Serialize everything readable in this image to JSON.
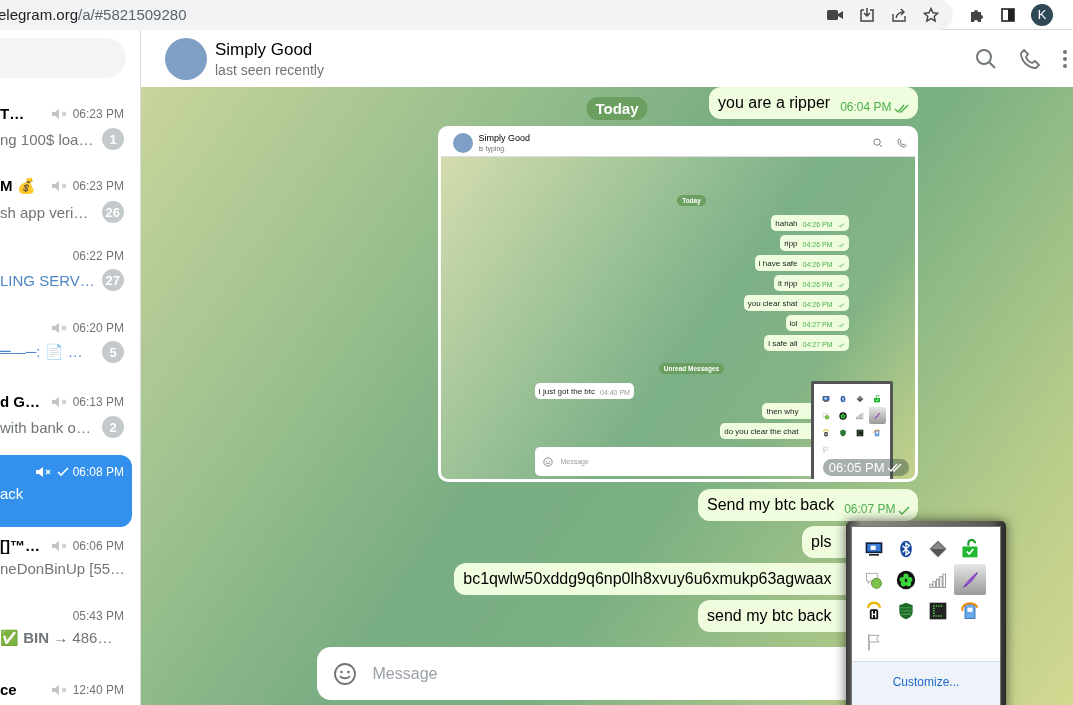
{
  "browser": {
    "url_host": "elegram.org",
    "url_path": "/a/#5821509280",
    "profile_initial": "K"
  },
  "sidebar": {
    "chats": [
      {
        "title": "T…",
        "muted": true,
        "sent_check": false,
        "time": "06:23 PM",
        "preview": "ng 100$ loa…",
        "preview_accent": false,
        "badge": "1",
        "selected": false
      },
      {
        "title": "M 💰",
        "muted": true,
        "sent_check": false,
        "time": "06:23 PM",
        "preview": "sh app veri…",
        "preview_accent": false,
        "badge": "26",
        "selected": false
      },
      {
        "muted": false,
        "sent_check": false,
        "time": "06:22 PM",
        "preview": "LING SERV…",
        "preview_accent": true,
        "badge": "27",
        "selected": false
      },
      {
        "muted": true,
        "sent_check": false,
        "time": "06:20 PM",
        "preview": "═—─: 📄 …",
        "preview_accent": true,
        "badge": "5",
        "selected": false
      },
      {
        "title": "d G…",
        "muted": true,
        "sent_check": false,
        "time": "06:13 PM",
        "preview": "with bank o…",
        "preview_accent": false,
        "badge": "2",
        "selected": false
      },
      {
        "muted": true,
        "sent_check": true,
        "time": "06:08 PM",
        "preview": "ack",
        "preview_accent": false,
        "selected": true
      },
      {
        "title": "[]™…",
        "muted": true,
        "sent_check": false,
        "time": "06:06 PM",
        "preview": "neDonBinUp [55…",
        "preview_accent": false,
        "selected": false
      },
      {
        "muted": false,
        "sent_check": false,
        "time": "05:43 PM",
        "preview": "✅ **BIN** → 486…",
        "preview_accent": false,
        "selected": false
      },
      {
        "title": "ce",
        "muted": true,
        "sent_check": false,
        "time": "12:40 PM",
        "selected": false
      }
    ]
  },
  "chat": {
    "title": "Simply Good",
    "status": "last seen recently",
    "sticky_date": "Today",
    "messages": [
      {
        "kind": "text",
        "text": "you are a ripper",
        "time": "06:04 PM",
        "read": true
      },
      {
        "kind": "screenshot",
        "time": "06:05 PM",
        "read": true,
        "screenshot": {
          "title": "Simply Good",
          "status": "is typing.",
          "date": "Today",
          "messages": [
            {
              "kind": "text",
              "out": true,
              "text": "hahah",
              "time": "04:26 PM"
            },
            {
              "kind": "text",
              "out": true,
              "text": "ripp",
              "time": "04:26 PM"
            },
            {
              "kind": "text",
              "out": true,
              "text": "i have safe",
              "time": "04:26 PM"
            },
            {
              "kind": "text",
              "out": true,
              "text": "it ripp",
              "time": "04:26 PM"
            },
            {
              "kind": "text",
              "out": true,
              "text": "you clear shat",
              "time": "04:26 PM"
            },
            {
              "kind": "text",
              "out": true,
              "text": "lol",
              "time": "04:27 PM"
            },
            {
              "kind": "text",
              "out": true,
              "text": "i safe all",
              "time": "04:27 PM"
            },
            {
              "kind": "divider",
              "text": "Unread Messages"
            },
            {
              "kind": "text",
              "out": false,
              "text": "I just got the btc",
              "time": "04:40 PM"
            },
            {
              "kind": "text",
              "out": true,
              "text": "then why"
            },
            {
              "kind": "text",
              "out": true,
              "text": "do you clear the chat"
            }
          ],
          "composer": {
            "placeholder": "Message"
          },
          "tray": {
            "icons": [
              {
                "kind": "monitor",
                "selected": false
              },
              {
                "kind": "bluetooth",
                "selected": false
              },
              {
                "kind": "diamond",
                "selected": false
              },
              {
                "kind": "padlock",
                "selected": false
              },
              {
                "kind": "bubble",
                "selected": false
              },
              {
                "kind": "clover",
                "selected": false
              },
              {
                "kind": "signal",
                "selected": false
              },
              {
                "kind": "feather",
                "selected": true
              },
              {
                "kind": "tower",
                "selected": false
              },
              {
                "kind": "shield",
                "selected": false
              },
              {
                "kind": "terminal",
                "selected": false
              },
              {
                "kind": "update",
                "selected": false
              },
              {
                "kind": "flag",
                "selected": false
              }
            ]
          }
        }
      },
      {
        "kind": "text",
        "text": "Send my btc back",
        "time": "06:07 PM",
        "read": false
      },
      {
        "kind": "text",
        "text": "pls"
      },
      {
        "kind": "text",
        "text": "bc1qwlw50xddg9q6np0lh8xvuy6u6xmukp63agwaax"
      },
      {
        "kind": "text",
        "text": "send my btc back"
      }
    ],
    "composer": {
      "placeholder": "Message"
    }
  },
  "tray": {
    "icons": [
      {
        "kind": "monitor",
        "selected": false
      },
      {
        "kind": "bluetooth",
        "selected": false
      },
      {
        "kind": "diamond",
        "selected": false
      },
      {
        "kind": "padlock",
        "selected": false
      },
      {
        "kind": "bubble",
        "selected": false
      },
      {
        "kind": "clover",
        "selected": false
      },
      {
        "kind": "signal",
        "selected": false
      },
      {
        "kind": "feather",
        "selected": true
      },
      {
        "kind": "tower",
        "selected": false
      },
      {
        "kind": "shield",
        "selected": false
      },
      {
        "kind": "terminal",
        "selected": false
      },
      {
        "kind": "update",
        "selected": false
      },
      {
        "kind": "flag",
        "selected": false
      }
    ],
    "link": "Customize..."
  }
}
